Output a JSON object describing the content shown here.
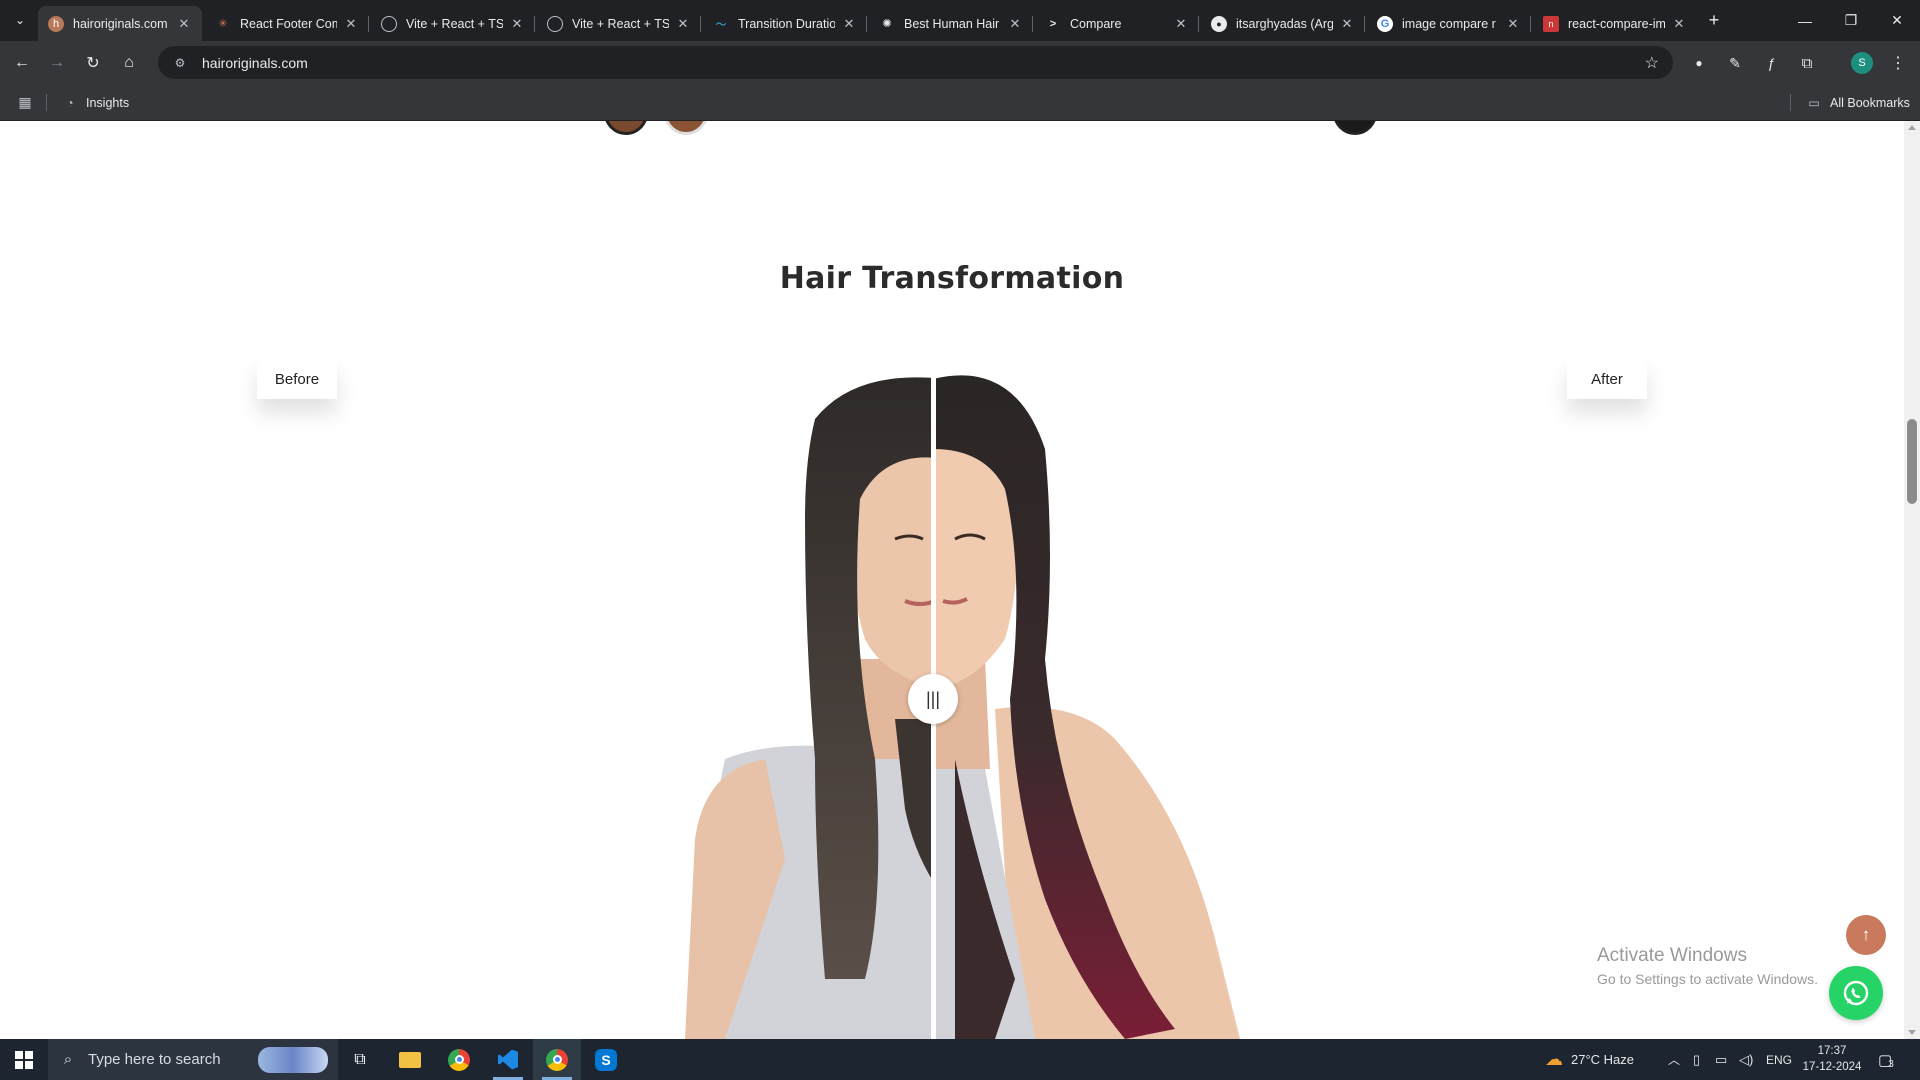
{
  "browser": {
    "tabs": [
      {
        "title": "hairoriginals.com",
        "favicon": "hairoriginals-logo-icon",
        "active": true
      },
      {
        "title": "React Footer Com",
        "favicon": "claude-icon",
        "active": false
      },
      {
        "title": "Vite + React + TS",
        "favicon": "globe-icon",
        "active": false
      },
      {
        "title": "Vite + React + TS",
        "favicon": "globe-icon",
        "active": false
      },
      {
        "title": "Transition Duratio",
        "favicon": "tailwind-icon",
        "active": false
      },
      {
        "title": "Best Human Hair",
        "favicon": "chatgpt-icon",
        "active": false
      },
      {
        "title": "Compare",
        "favicon": "prompt-icon",
        "active": false
      },
      {
        "title": "itsarghyadas (Arg",
        "favicon": "github-icon",
        "active": false
      },
      {
        "title": "image compare r",
        "favicon": "google-icon",
        "active": false
      },
      {
        "title": "react-compare-im",
        "favicon": "npm-icon",
        "active": false
      }
    ],
    "url": "hairoriginals.com",
    "bookmarks": {
      "items": [
        {
          "label": "Insights",
          "icon": "insights-icon"
        }
      ],
      "all_label": "All Bookmarks"
    },
    "profile_initial": "S"
  },
  "page": {
    "section_title": "Hair Transformation",
    "before_label": "Before",
    "after_label": "After",
    "slider_position": 0.5,
    "watermark": {
      "line1": "Activate Windows",
      "line2": "Go to Settings to activate Windows."
    },
    "colors": {
      "accent": "#c97a5c",
      "whatsapp": "#25d366"
    }
  },
  "taskbar": {
    "search_placeholder": "Type here to search",
    "weather": "27°C  Haze",
    "lang": "ENG",
    "time": "17:37",
    "date": "17-12-2024",
    "notification_count": "3"
  }
}
